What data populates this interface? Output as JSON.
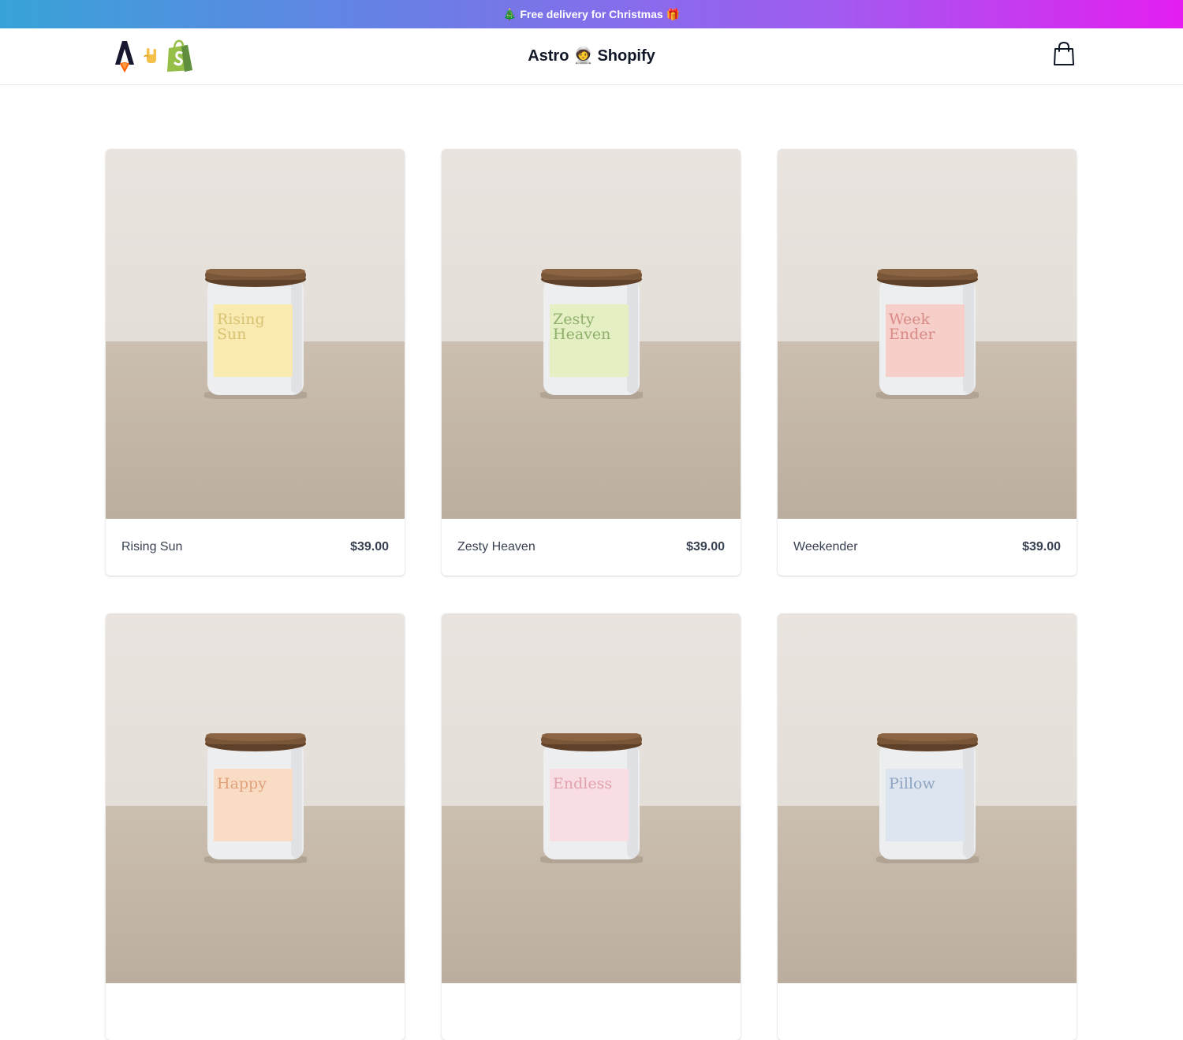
{
  "promo": {
    "left_emoji": "🎄",
    "text": "Free delivery for Christmas",
    "right_emoji": "🎁"
  },
  "header": {
    "title": "Astro 🧑‍🚀 Shopify",
    "logo_icons": [
      "astro-logo-icon",
      "rock-hand-icon",
      "shopify-bag-icon"
    ],
    "cart_icon": "shopping-bag-icon"
  },
  "products": [
    {
      "name": "Rising Sun",
      "price": "$39.00",
      "label_text": [
        "Rising",
        "Sun"
      ],
      "label_color": "#f8eab0",
      "label_ink": "#d8c373"
    },
    {
      "name": "Zesty Heaven",
      "price": "$39.00",
      "label_text": [
        "Zesty",
        "Heaven"
      ],
      "label_color": "#e4efc4",
      "label_ink": "#8fb06a"
    },
    {
      "name": "Weekender",
      "price": "$39.00",
      "label_text": [
        "Week",
        "Ender"
      ],
      "label_color": "#f6cfcb",
      "label_ink": "#d98a84"
    },
    {
      "name": "",
      "price": "",
      "label_text": [
        "Happy",
        ""
      ],
      "label_color": "#f8dcc4",
      "label_ink": "#e0a07a"
    },
    {
      "name": "",
      "price": "",
      "label_text": [
        "Endless",
        ""
      ],
      "label_color": "#f8dde3",
      "label_ink": "#e0a1b1"
    },
    {
      "name": "",
      "price": "",
      "label_text": [
        "Pillow",
        ""
      ],
      "label_color": "#dde6f0",
      "label_ink": "#8ea4c0"
    }
  ],
  "colors": {
    "promo_gradient_start": "#38a3d8",
    "promo_gradient_end": "#e41ef0",
    "wood_lid": "#7a5638",
    "jar": "#eceef0"
  }
}
